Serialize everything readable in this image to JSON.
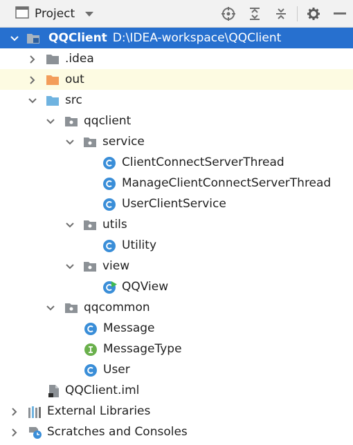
{
  "toolbar": {
    "title": "Project",
    "icons": [
      "project-view-icon",
      "dropdown-caret-icon",
      "locate-icon",
      "expand-all-icon",
      "collapse-all-icon",
      "gear-icon",
      "minimize-icon"
    ]
  },
  "tree": {
    "root": {
      "name": "QQClient",
      "path": "D:\\IDEA-workspace\\QQClient"
    },
    "idea": ".idea",
    "out": "out",
    "src": "src",
    "qqclient": "qqclient",
    "service": "service",
    "service_files": [
      "ClientConnectServerThread",
      "ManageClientConnectServerThread",
      "UserClientService"
    ],
    "utils": "utils",
    "utility": "Utility",
    "view": "view",
    "qqview": "QQView",
    "qqcommon": "qqcommon",
    "message": "Message",
    "message_type": "MessageType",
    "user": "User",
    "iml": "QQClient.iml",
    "external_libraries": "External Libraries",
    "scratches": "Scratches and Consoles"
  },
  "colors": {
    "selection": "#2770cf",
    "highlight_row": "#fdfbe2",
    "class_icon": "#3a8ed8",
    "interface_icon": "#6ab04c",
    "folder_gray": "#8c9196",
    "folder_blue": "#6fb3e0",
    "folder_orange": "#f39d5a"
  }
}
